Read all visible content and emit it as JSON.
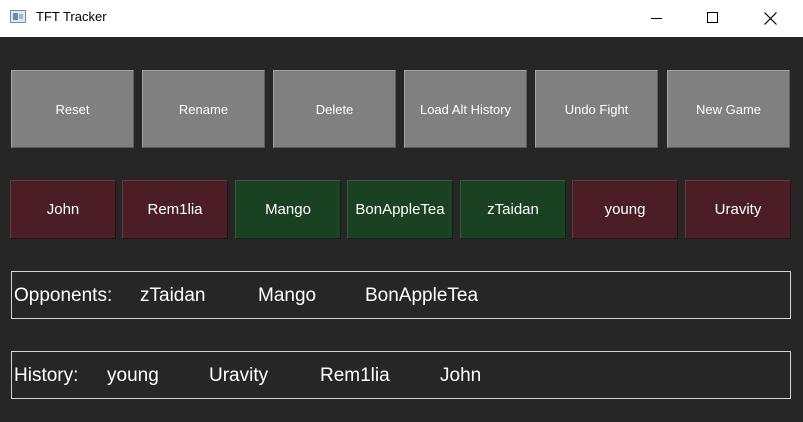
{
  "window": {
    "title": "TFT Tracker",
    "icon": "app-window-icon",
    "controls": [
      "minimize-icon",
      "maximize-icon",
      "close-icon"
    ]
  },
  "actions": [
    {
      "label": "Reset"
    },
    {
      "label": "Rename"
    },
    {
      "label": "Delete"
    },
    {
      "label": "Load Alt History"
    },
    {
      "label": "Undo Fight"
    },
    {
      "label": "New Game"
    }
  ],
  "players": [
    {
      "name": "John",
      "status": "history",
      "color": "#4a1e24"
    },
    {
      "name": "Rem1lia",
      "status": "history",
      "color": "#4a1e24"
    },
    {
      "name": "Mango",
      "status": "opponent",
      "color": "#1a4222"
    },
    {
      "name": "BonAppleTea",
      "status": "opponent",
      "color": "#1a4222"
    },
    {
      "name": "zTaidan",
      "status": "opponent",
      "color": "#1a4222"
    },
    {
      "name": "young",
      "status": "history",
      "color": "#4a1e24"
    },
    {
      "name": "Uravity",
      "status": "history",
      "color": "#4a1e24"
    }
  ],
  "opponents": {
    "label": "Opponents:",
    "names": [
      "zTaidan",
      "Mango",
      "BonAppleTea"
    ]
  },
  "history": {
    "label": "History:",
    "names": [
      "young",
      "Uravity",
      "Rem1lia",
      "John"
    ]
  },
  "colors": {
    "background": "#262626",
    "button_gray": "#808080",
    "history_red": "#4a1e24",
    "opponent_green": "#1a4222",
    "box_border": "#d4d4d4"
  }
}
